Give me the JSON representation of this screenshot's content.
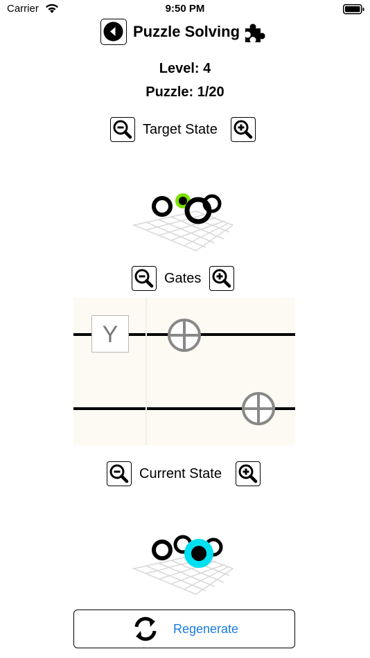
{
  "status_bar": {
    "carrier": "Carrier",
    "time": "9:50 PM"
  },
  "header": {
    "title": "Puzzle Solving",
    "back_icon": "back-arrow-icon",
    "puzzle_icon": "puzzle-piece-icon"
  },
  "info": {
    "level": "Level: 4",
    "puzzle": "Puzzle: 1/20"
  },
  "target_state": {
    "label": "Target State"
  },
  "gates": {
    "label": "Gates",
    "y_gate_label": "Y"
  },
  "current_state": {
    "label": "Current State"
  },
  "regenerate": {
    "label": "Regenerate"
  },
  "colors": {
    "accent": "#1a7be0",
    "target_highlight": "#7be000",
    "current_highlight": "#00e0f0",
    "gate_grey": "#888888"
  }
}
